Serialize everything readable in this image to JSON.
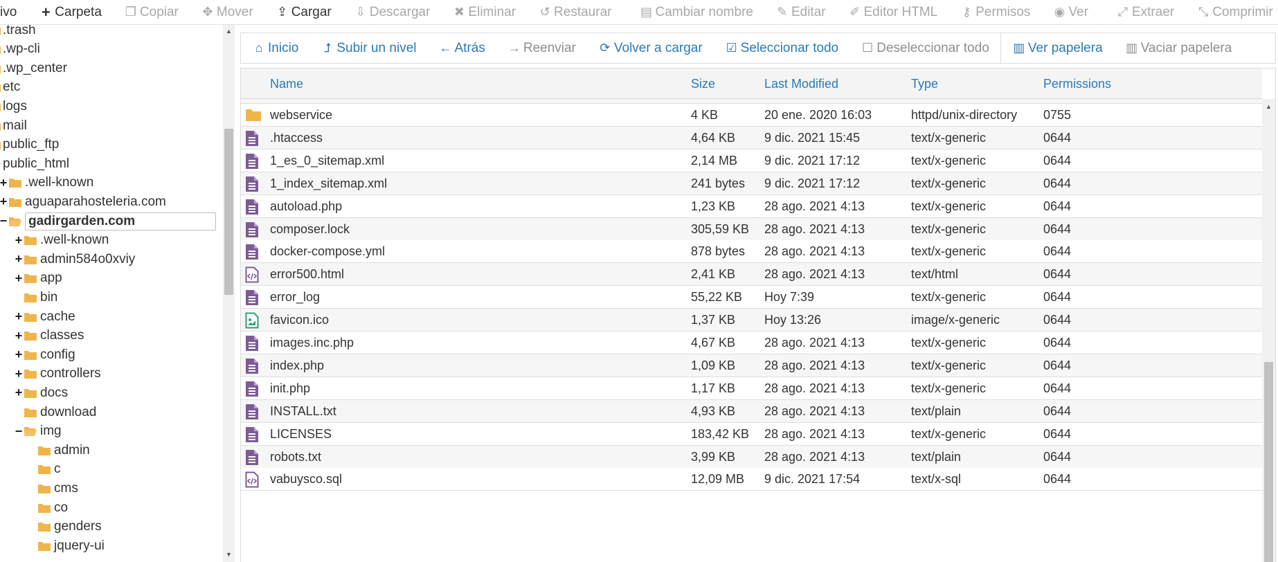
{
  "toolbar": {
    "items": [
      {
        "label": "ivo",
        "icon": "",
        "enabled": true
      },
      {
        "label": "Carpeta",
        "icon": "plus-icon",
        "enabled": true
      },
      {
        "label": "Copiar",
        "icon": "copy-icon",
        "enabled": false
      },
      {
        "label": "Mover",
        "icon": "move-icon",
        "enabled": false
      },
      {
        "label": "Cargar",
        "icon": "upload-icon",
        "enabled": true
      },
      {
        "label": "Descargar",
        "icon": "download-icon",
        "enabled": false
      },
      {
        "label": "Eliminar",
        "icon": "close-icon",
        "enabled": false
      },
      {
        "label": "Restaurar",
        "icon": "undo-icon",
        "enabled": false
      },
      {
        "label": "Cambiar nombre",
        "icon": "file-icon",
        "enabled": false
      },
      {
        "label": "Editar",
        "icon": "pencil-icon",
        "enabled": false
      },
      {
        "label": "Editor HTML",
        "icon": "edit-icon",
        "enabled": false
      },
      {
        "label": "Permisos",
        "icon": "key-icon",
        "enabled": false
      },
      {
        "label": "Ver",
        "icon": "eye-icon",
        "enabled": false
      },
      {
        "label": "Extraer",
        "icon": "expand-icon",
        "enabled": false
      },
      {
        "label": "Comprimir",
        "icon": "compress-icon",
        "enabled": false
      }
    ]
  },
  "tree": {
    "items": [
      {
        "label": ".trash",
        "indent": 0,
        "toggle": "",
        "open": false,
        "selected": false
      },
      {
        "label": ".wp-cli",
        "indent": 0,
        "toggle": "",
        "open": false,
        "selected": false
      },
      {
        "label": ".wp_center",
        "indent": 0,
        "toggle": "",
        "open": false,
        "selected": false
      },
      {
        "label": "etc",
        "indent": 0,
        "toggle": "",
        "open": false,
        "selected": false
      },
      {
        "label": "logs",
        "indent": 0,
        "toggle": "",
        "open": false,
        "selected": false
      },
      {
        "label": "mail",
        "indent": 0,
        "toggle": "",
        "open": false,
        "selected": false
      },
      {
        "label": "public_ftp",
        "indent": 0,
        "toggle": "",
        "open": false,
        "selected": false
      },
      {
        "label": "public_html",
        "indent": 0,
        "toggle": "",
        "open": true,
        "selected": false
      },
      {
        "label": ".well-known",
        "indent": 1,
        "toggle": "+",
        "open": false,
        "selected": false
      },
      {
        "label": "aguaparahosteleria.com",
        "indent": 1,
        "toggle": "+",
        "open": false,
        "selected": false
      },
      {
        "label": "gadirgarden.com",
        "indent": 1,
        "toggle": "−",
        "open": true,
        "selected": true
      },
      {
        "label": ".well-known",
        "indent": 2,
        "toggle": "+",
        "open": false,
        "selected": false
      },
      {
        "label": "admin584o0xviy",
        "indent": 2,
        "toggle": "+",
        "open": false,
        "selected": false
      },
      {
        "label": "app",
        "indent": 2,
        "toggle": "+",
        "open": false,
        "selected": false
      },
      {
        "label": "bin",
        "indent": 2,
        "toggle": "",
        "open": false,
        "selected": false
      },
      {
        "label": "cache",
        "indent": 2,
        "toggle": "+",
        "open": false,
        "selected": false
      },
      {
        "label": "classes",
        "indent": 2,
        "toggle": "+",
        "open": false,
        "selected": false
      },
      {
        "label": "config",
        "indent": 2,
        "toggle": "+",
        "open": false,
        "selected": false
      },
      {
        "label": "controllers",
        "indent": 2,
        "toggle": "+",
        "open": false,
        "selected": false
      },
      {
        "label": "docs",
        "indent": 2,
        "toggle": "+",
        "open": false,
        "selected": false
      },
      {
        "label": "download",
        "indent": 2,
        "toggle": "",
        "open": false,
        "selected": false
      },
      {
        "label": "img",
        "indent": 2,
        "toggle": "−",
        "open": true,
        "selected": false
      },
      {
        "label": "admin",
        "indent": 3,
        "toggle": "",
        "open": false,
        "selected": false
      },
      {
        "label": "c",
        "indent": 3,
        "toggle": "",
        "open": false,
        "selected": false
      },
      {
        "label": "cms",
        "indent": 3,
        "toggle": "",
        "open": false,
        "selected": false
      },
      {
        "label": "co",
        "indent": 3,
        "toggle": "",
        "open": false,
        "selected": false
      },
      {
        "label": "genders",
        "indent": 3,
        "toggle": "",
        "open": false,
        "selected": false
      },
      {
        "label": "jquery-ui",
        "indent": 3,
        "toggle": "",
        "open": false,
        "selected": false
      }
    ]
  },
  "actionbar": {
    "items": [
      {
        "label": "Inicio",
        "icon": "home-icon",
        "enabled": true
      },
      {
        "label": "Subir un nivel",
        "icon": "level-up-icon",
        "enabled": true
      },
      {
        "label": "Atrás",
        "icon": "arrow-left-icon",
        "enabled": true
      },
      {
        "label": "Reenviar",
        "icon": "arrow-right-icon",
        "enabled": false
      },
      {
        "label": "Volver a cargar",
        "icon": "refresh-icon",
        "enabled": true
      },
      {
        "label": "Seleccionar todo",
        "icon": "checkbox-checked-icon",
        "enabled": true
      },
      {
        "label": "Deseleccionar todo",
        "icon": "checkbox-empty-icon",
        "enabled": false
      },
      {
        "label": "Ver papelera",
        "icon": "trash-icon",
        "enabled": true
      },
      {
        "label": "Vaciar papelera",
        "icon": "trash-icon",
        "enabled": false
      }
    ]
  },
  "table": {
    "headers": {
      "name": "Name",
      "size": "Size",
      "modified": "Last Modified",
      "type": "Type",
      "permissions": "Permissions"
    },
    "rows": [
      {
        "icon": "folder-icon",
        "name": "webservice",
        "size": "4 KB",
        "modified": "20 ene. 2020 16:03",
        "type": "httpd/unix-directory",
        "permissions": "0755"
      },
      {
        "icon": "file-text-icon",
        "name": ".htaccess",
        "size": "4,64 KB",
        "modified": "9 dic. 2021 15:45",
        "type": "text/x-generic",
        "permissions": "0644"
      },
      {
        "icon": "file-text-icon",
        "name": "1_es_0_sitemap.xml",
        "size": "2,14 MB",
        "modified": "9 dic. 2021 17:12",
        "type": "text/x-generic",
        "permissions": "0644"
      },
      {
        "icon": "file-text-icon",
        "name": "1_index_sitemap.xml",
        "size": "241 bytes",
        "modified": "9 dic. 2021 17:12",
        "type": "text/x-generic",
        "permissions": "0644"
      },
      {
        "icon": "file-text-icon",
        "name": "autoload.php",
        "size": "1,23 KB",
        "modified": "28 ago. 2021 4:13",
        "type": "text/x-generic",
        "permissions": "0644"
      },
      {
        "icon": "file-text-icon",
        "name": "composer.lock",
        "size": "305,59 KB",
        "modified": "28 ago. 2021 4:13",
        "type": "text/x-generic",
        "permissions": "0644"
      },
      {
        "icon": "file-text-icon",
        "name": "docker-compose.yml",
        "size": "878 bytes",
        "modified": "28 ago. 2021 4:13",
        "type": "text/x-generic",
        "permissions": "0644"
      },
      {
        "icon": "file-code-icon",
        "name": "error500.html",
        "size": "2,41 KB",
        "modified": "28 ago. 2021 4:13",
        "type": "text/html",
        "permissions": "0644"
      },
      {
        "icon": "file-text-icon",
        "name": "error_log",
        "size": "55,22 KB",
        "modified": "Hoy 7:39",
        "type": "text/x-generic",
        "permissions": "0644"
      },
      {
        "icon": "file-image-icon",
        "name": "favicon.ico",
        "size": "1,37 KB",
        "modified": "Hoy 13:26",
        "type": "image/x-generic",
        "permissions": "0644"
      },
      {
        "icon": "file-text-icon",
        "name": "images.inc.php",
        "size": "4,67 KB",
        "modified": "28 ago. 2021 4:13",
        "type": "text/x-generic",
        "permissions": "0644"
      },
      {
        "icon": "file-text-icon",
        "name": "index.php",
        "size": "1,09 KB",
        "modified": "28 ago. 2021 4:13",
        "type": "text/x-generic",
        "permissions": "0644"
      },
      {
        "icon": "file-text-icon",
        "name": "init.php",
        "size": "1,17 KB",
        "modified": "28 ago. 2021 4:13",
        "type": "text/x-generic",
        "permissions": "0644"
      },
      {
        "icon": "file-text-icon",
        "name": "INSTALL.txt",
        "size": "4,93 KB",
        "modified": "28 ago. 2021 4:13",
        "type": "text/plain",
        "permissions": "0644"
      },
      {
        "icon": "file-text-icon",
        "name": "LICENSES",
        "size": "183,42 KB",
        "modified": "28 ago. 2021 4:13",
        "type": "text/x-generic",
        "permissions": "0644"
      },
      {
        "icon": "file-text-icon",
        "name": "robots.txt",
        "size": "3,99 KB",
        "modified": "28 ago. 2021 4:13",
        "type": "text/plain",
        "permissions": "0644"
      },
      {
        "icon": "file-code-icon",
        "name": "vabuysco.sql",
        "size": "12,09 MB",
        "modified": "9 dic. 2021 17:54",
        "type": "text/x-sql",
        "permissions": "0644"
      }
    ]
  },
  "colors": {
    "link": "#2a7ab8",
    "folder": "#f0b54a",
    "file_text": "#7d5c96",
    "file_image": "#2d9e7a",
    "disabled": "#a8a8a8"
  }
}
